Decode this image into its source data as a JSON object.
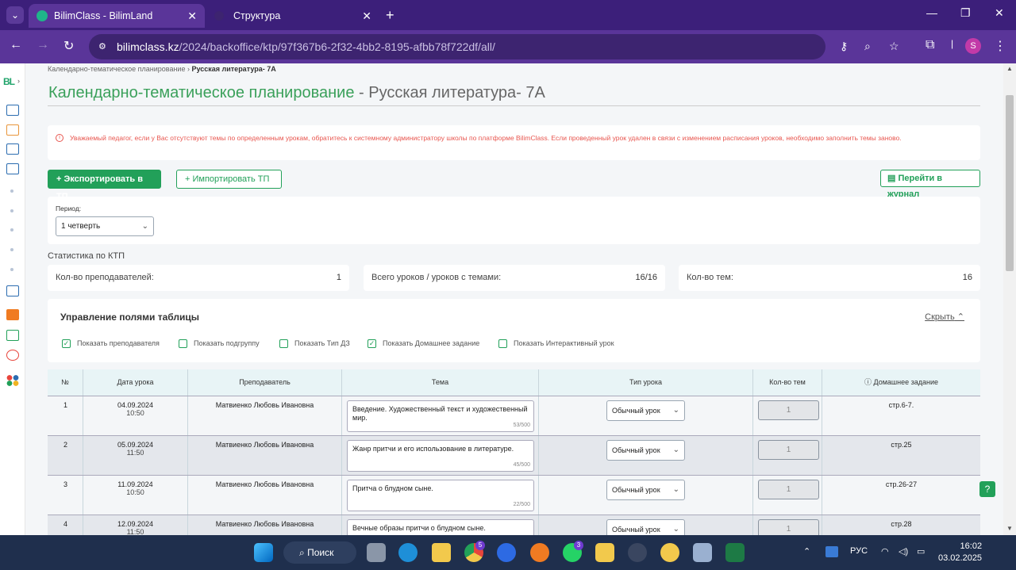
{
  "browser": {
    "tabs": [
      {
        "label": "BilimClass - BilimLand"
      },
      {
        "label": "Структура"
      }
    ],
    "url_host": "bilimclass.kz",
    "url_path": "/2024/backoffice/ktp/97f367b6-2f32-4bb2-8195-afbb78f722df/all/",
    "profile_initial": "S"
  },
  "sidebar": {
    "logo": "BL"
  },
  "breadcrumb": {
    "parent": "Календарно-тематическое планирование",
    "current": "Русская литература- 7А"
  },
  "page": {
    "title": "Календарно-тематическое планирование",
    "subtitle": "- Русская литература- 7А"
  },
  "alert": {
    "text": "Уважаемый педагог, если у Вас отсутствуют темы по определенным урокам, обратитесь к системному администратору школы по платформе BilimClass. Если проведенный урок удален в связи с изменением расписания уроков, необходимо заполнить темы заново."
  },
  "actions": {
    "export": "Экспортировать в ТП",
    "import": "Импортировать ТП",
    "journal": "Перейти в журнал"
  },
  "period": {
    "label": "Период:",
    "value": "1 четверть"
  },
  "stats": {
    "title": "Статистика по КТП",
    "teachers_label": "Кол-во преподавателей:",
    "teachers_value": "1",
    "lessons_label": "Всего уроков / уроков с темами:",
    "lessons_value": "16/16",
    "topics_label": "Кол-во тем:",
    "topics_value": "16"
  },
  "manage": {
    "title": "Управление полями таблицы",
    "hide": "Скрыть",
    "options": [
      {
        "label": "Показать преподавателя",
        "checked": true
      },
      {
        "label": "Показать подгруппу",
        "checked": false
      },
      {
        "label": "Показать Тип ДЗ",
        "checked": false
      },
      {
        "label": "Показать Домашнее задание",
        "checked": true
      },
      {
        "label": "Показать Интерактивный урок",
        "checked": false
      }
    ]
  },
  "table": {
    "headers": [
      "№",
      "Дата урока",
      "Преподаватель",
      "Тема",
      "Тип урока",
      "Кол-во тем",
      "Домашнее задание"
    ],
    "rows": [
      {
        "num": "1",
        "date": "04.09.2024",
        "time": "10:50",
        "teacher": "Матвиенко Любовь Ивановна",
        "topic": "Введение. Художественный текст и художественный мир.",
        "count_chars": "53/500",
        "type": "Обычный урок",
        "topics": "1",
        "hw": "стр.6-7."
      },
      {
        "num": "2",
        "date": "05.09.2024",
        "time": "11:50",
        "teacher": "Матвиенко Любовь Ивановна",
        "topic": "Жанр притчи и его использование в литературе.",
        "count_chars": "45/500",
        "type": "Обычный урок",
        "topics": "1",
        "hw": "стр.25"
      },
      {
        "num": "3",
        "date": "11.09.2024",
        "time": "10:50",
        "teacher": "Матвиенко Любовь Ивановна",
        "topic": "Притча о блудном сыне.",
        "count_chars": "22/500",
        "type": "Обычный урок",
        "topics": "1",
        "hw": "стр.26-27"
      },
      {
        "num": "4",
        "date": "12.09.2024",
        "time": "11:50",
        "teacher": "Матвиенко Любовь Ивановна",
        "topic": "Вечные образы притчи о блудном сыне.",
        "count_chars": "",
        "type": "Обычный урок",
        "topics": "1",
        "hw": "стр.28"
      }
    ]
  },
  "taskbar": {
    "search": "Поиск",
    "lang": "РУС",
    "time": "16:02",
    "date": "03.02.2025",
    "chrome_badge": "5",
    "whatsapp_badge": "3"
  }
}
